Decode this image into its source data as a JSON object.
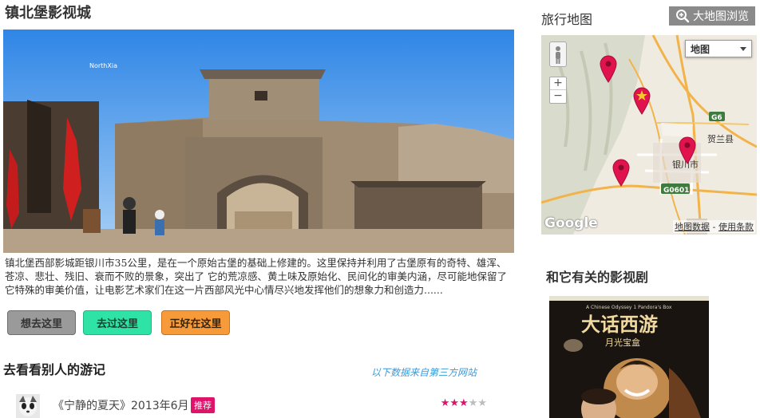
{
  "page": {
    "title": "镇北堡影视城",
    "description": "镇北堡西部影城距银川市35公里，是在一个原始古堡的基础上修建的。这里保持并利用了古堡原有的奇特、雄浑、苍凉、悲壮、残旧、衰而不败的景象，突出了 它的荒凉感、黄土味及原始化、民间化的审美内涵，尽可能地保留了它特殊的审美价值，让电影艺术家们在这一片西部风光中心情尽兴地发挥他们的想象力和创造力......",
    "hero_watermark": "NorthXia"
  },
  "actions": {
    "want": "想去这里",
    "been": "去过这里",
    "here": "正好在这里"
  },
  "notes": {
    "title": "去看看别人的游记",
    "source": "以下数据来自第三方网站",
    "items": [
      {
        "title": "《宁静的夏天》2013年6月",
        "badge": "推荐",
        "rating": 3,
        "max_rating": 5
      }
    ]
  },
  "map": {
    "title": "旅行地图",
    "big_map_button": "大地图浏览",
    "type_select": "地图",
    "labels": {
      "city": "银川市",
      "county": "贺兰县",
      "road1": "G6",
      "road2": "G0601"
    },
    "credit_data": "地图数据",
    "credit_sep": " - ",
    "credit_terms": "使用条款",
    "logo": "Google",
    "zoom_in": "+",
    "zoom_out": "−"
  },
  "related": {
    "title": "和它有关的影视剧",
    "poster_title": "大话西游",
    "poster_subtitle": "月光宝盒",
    "poster_top": "A Chinese Odyssey 1  Pandora's Box"
  },
  "colors": {
    "want": "#9a9a9a",
    "been": "#2ee3a5",
    "here": "#f79a3a",
    "badge": "#e0136a",
    "link": "#3a9ad9",
    "marker": "#e0134f"
  }
}
